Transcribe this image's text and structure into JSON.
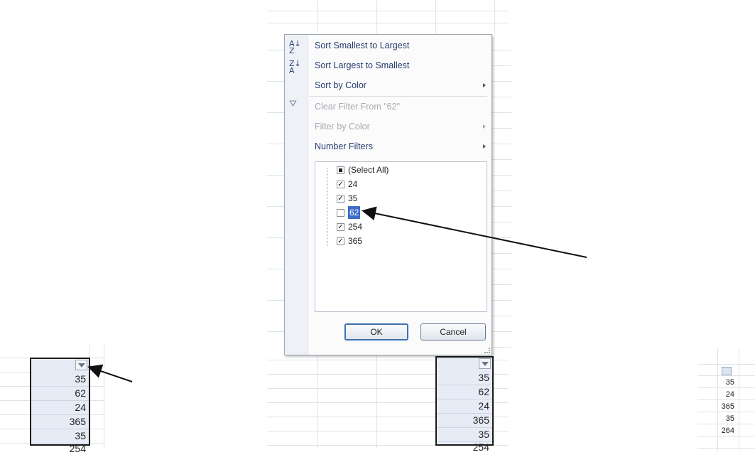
{
  "left_column": {
    "values": [
      "35",
      "62",
      "24",
      "365",
      "35",
      "254"
    ]
  },
  "filter_menu": {
    "items": [
      {
        "label": "Sort Smallest to Largest",
        "icon": "sort-ascending-icon",
        "enabled": true
      },
      {
        "label": "Sort Largest to Smallest",
        "icon": "sort-descending-icon",
        "enabled": true
      },
      {
        "label": "Sort by Color",
        "icon": "",
        "enabled": true,
        "submenu": true
      },
      {
        "label": "Clear Filter From \"62\"",
        "icon": "clear-filter-icon",
        "enabled": false
      },
      {
        "label": "Filter by Color",
        "icon": "",
        "enabled": false,
        "submenu": true
      },
      {
        "label": "Number Filters",
        "icon": "",
        "enabled": true,
        "submenu": true
      }
    ],
    "list": [
      {
        "label": "(Select All)",
        "state": "partial"
      },
      {
        "label": "24",
        "state": "checked"
      },
      {
        "label": "35",
        "state": "checked"
      },
      {
        "label": "62",
        "state": "unchecked",
        "selected": true
      },
      {
        "label": "254",
        "state": "checked"
      },
      {
        "label": "365",
        "state": "checked"
      }
    ],
    "ok_label": "OK",
    "cancel_label": "Cancel"
  },
  "middle_column": {
    "values": [
      "35",
      "62",
      "24",
      "365",
      "35",
      "254"
    ]
  },
  "right_column": {
    "values": [
      "35",
      "24",
      "365",
      "35",
      "264"
    ]
  },
  "colors": {
    "accent": "#3b6ec6",
    "cell_fill": "#e6ebf5",
    "menu_text": "#233a6e"
  }
}
